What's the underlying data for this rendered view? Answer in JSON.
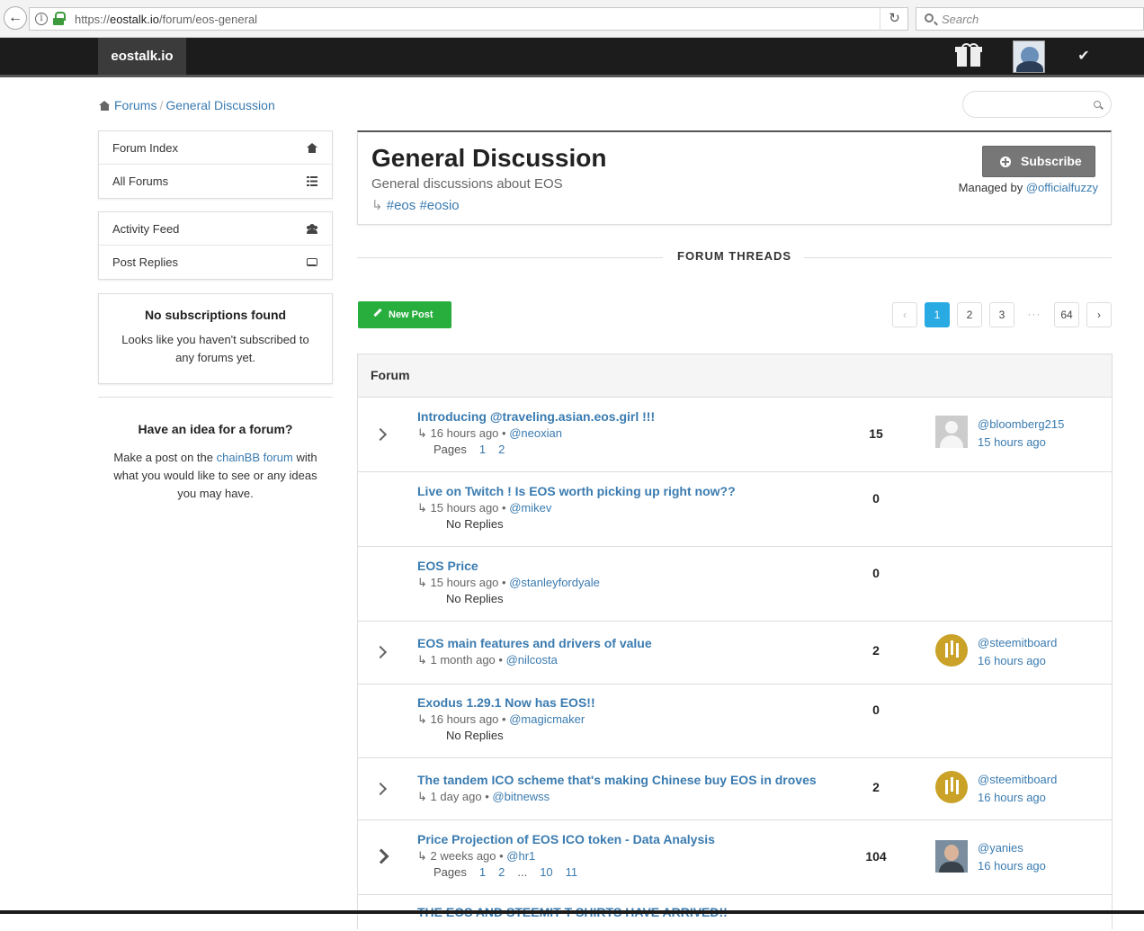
{
  "browser": {
    "url_prefix": "https://",
    "url_domain": "eostalk.io",
    "url_path": "/forum/eos-general",
    "search_placeholder": "Search"
  },
  "topnav": {
    "brand": "eostalk.io"
  },
  "breadcrumb": {
    "items": [
      "Forums",
      "General Discussion"
    ]
  },
  "sidebar": {
    "menu1": [
      "Forum Index",
      "All Forums"
    ],
    "menu2": [
      "Activity Feed",
      "Post Replies"
    ],
    "no_subs_title": "No subscriptions found",
    "no_subs_text": "Looks like you haven't subscribed to any forums yet.",
    "idea_title": "Have an idea for a forum?",
    "idea_text_before": "Make a post on the ",
    "idea_link": "chainBB forum",
    "idea_text_after": " with what you would like to see or any ideas you may have."
  },
  "forum": {
    "title": "General Discussion",
    "description": "General discussions about EOS",
    "tag_prefix": "↳ ",
    "tags": "#eos #eosio",
    "subscribe_label": "Subscribe",
    "managed_label": "Managed by ",
    "manager": "@officialfuzzy"
  },
  "threads_heading": "FORUM THREADS",
  "new_post_label": "New Post",
  "pagination": {
    "prev": "‹",
    "pages": [
      "1",
      "2",
      "3"
    ],
    "ellipsis": "···",
    "last": "64",
    "next": "›",
    "active": "1"
  },
  "table": {
    "header": "Forum",
    "pages_label": "Pages",
    "no_replies": "No Replies",
    "rows": [
      {
        "title": "Introducing @traveling.asian.eos.girl !!!",
        "age": "16 hours ago",
        "author": "@neoxian",
        "pages": [
          "1",
          "2"
        ],
        "replies": "15",
        "last_user": "@bloomberg215",
        "last_time": "15 hours ago",
        "avatar": "default-avatar"
      },
      {
        "title": "Live on Twitch ! Is EOS worth picking up right now??",
        "age": "15 hours ago",
        "author": "@mikev",
        "replies": "0"
      },
      {
        "title": "EOS Price",
        "age": "15 hours ago",
        "author": "@stanleyfordyale",
        "replies": "0"
      },
      {
        "title": "EOS main features and drivers of value",
        "age": "1 month ago",
        "author": "@nilcosta",
        "replies": "2",
        "last_user": "@steemitboard",
        "last_time": "16 hours ago",
        "avatar": "steemitboard-avatar"
      },
      {
        "title": "Exodus 1.29.1 Now has EOS!!",
        "age": "16 hours ago",
        "author": "@magicmaker",
        "replies": "0"
      },
      {
        "title": "The tandem ICO scheme that's making Chinese buy EOS in droves",
        "age": "1 day ago",
        "author": "@bitnewss",
        "replies": "2",
        "last_user": "@steemitboard",
        "last_time": "16 hours ago",
        "avatar": "steemitboard-avatar"
      },
      {
        "title": "Price Projection of EOS ICO token - Data Analysis",
        "age": "2 weeks ago",
        "author": "@hr1",
        "pages": [
          "1",
          "2",
          "...",
          "10",
          "11"
        ],
        "replies": "104",
        "last_user": "@yanies",
        "last_time": "16 hours ago",
        "avatar": "photo-avatar"
      },
      {
        "title": "THE EOS AND STEEMIT T-SHIRTS HAVE ARRIVED!!"
      }
    ]
  },
  "colors": {
    "link": "#3a7bb0",
    "nav_bg": "#1c1c1c",
    "new_post_green": "#27ae3c",
    "active_page_blue": "#29aae2",
    "subscribe_gray": "#777777"
  },
  "icons": {
    "back": "arrow-left-icon",
    "reload": "reload-icon",
    "gift": "gift-icon",
    "check": "check-icon",
    "home": "home-icon",
    "list": "list-icon",
    "users": "users-icon",
    "inbox": "inbox-icon"
  }
}
